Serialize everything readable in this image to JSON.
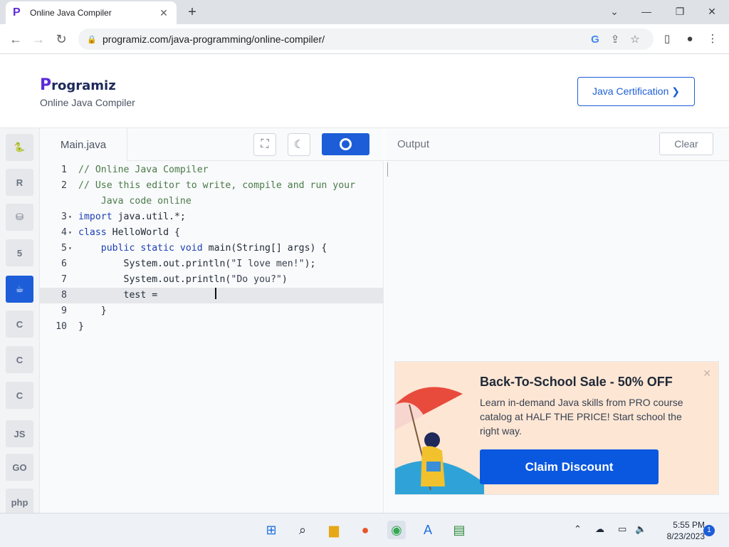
{
  "browser": {
    "tab_title": "Online Java Compiler",
    "tab_close": "✕",
    "new_tab": "+",
    "url": "programiz.com/java-programming/online-compiler/"
  },
  "site": {
    "logo_initial": "P",
    "logo_rest": "rogramiz",
    "subtitle": "Online Java Compiler",
    "cert_button": "Java Certification ❯"
  },
  "sidebar": {
    "items": [
      {
        "name": "python",
        "glyph": "🐍"
      },
      {
        "name": "r",
        "glyph": "R"
      },
      {
        "name": "sql",
        "glyph": "⛁"
      },
      {
        "name": "html",
        "glyph": "5"
      },
      {
        "name": "java",
        "glyph": "☕"
      },
      {
        "name": "c",
        "glyph": "C"
      },
      {
        "name": "cpp",
        "glyph": "C"
      },
      {
        "name": "csharp",
        "glyph": "C"
      },
      {
        "name": "js",
        "glyph": "JS"
      },
      {
        "name": "go",
        "glyph": "GO"
      },
      {
        "name": "php",
        "glyph": "php"
      }
    ],
    "active": "java"
  },
  "editor": {
    "file_tab": "Main.java",
    "lines": [
      {
        "n": "1",
        "fold": "",
        "html": "<span class='cm'>// Online Java Compiler</span>"
      },
      {
        "n": "2",
        "fold": "",
        "html": "<span class='cm'>// Use this editor to write, compile and run your</span>"
      },
      {
        "n": "",
        "fold": "",
        "html": "<span class='cm'>    Java code online</span>"
      },
      {
        "n": "3",
        "fold": "▾",
        "html": "<span class='kw'>import</span> java.util.*;"
      },
      {
        "n": "4",
        "fold": "▾",
        "html": "<span class='kw'>class</span> HelloWorld {"
      },
      {
        "n": "5",
        "fold": "▾",
        "html": "    <span class='kw'>public static void</span> main(String[] args) {"
      },
      {
        "n": "6",
        "fold": "",
        "html": "        System.out.println(<span class='st'>\"I love men!\"</span>);"
      },
      {
        "n": "7",
        "fold": "",
        "html": "        System.out.println(<span class='st'>\"Do you?\"</span>)"
      },
      {
        "n": "8",
        "fold": "",
        "html": "        test =",
        "highlight": true
      },
      {
        "n": "9",
        "fold": "",
        "html": "    }"
      },
      {
        "n": "10",
        "fold": "",
        "html": "}"
      }
    ]
  },
  "output": {
    "label": "Output",
    "clear_button": "Clear"
  },
  "promo": {
    "title": "Back-To-School Sale - 50% OFF",
    "description": "Learn in-demand Java skills from PRO course catalog at HALF THE PRICE! Start school the right way.",
    "button": "Claim Discount",
    "close": "✕"
  },
  "taskbar": {
    "time": "5:55 PM",
    "date": "8/23/2023",
    "notifications": "1"
  },
  "colors": {
    "accent": "#1d5ed8",
    "promo_bg": "#fde6d4"
  }
}
